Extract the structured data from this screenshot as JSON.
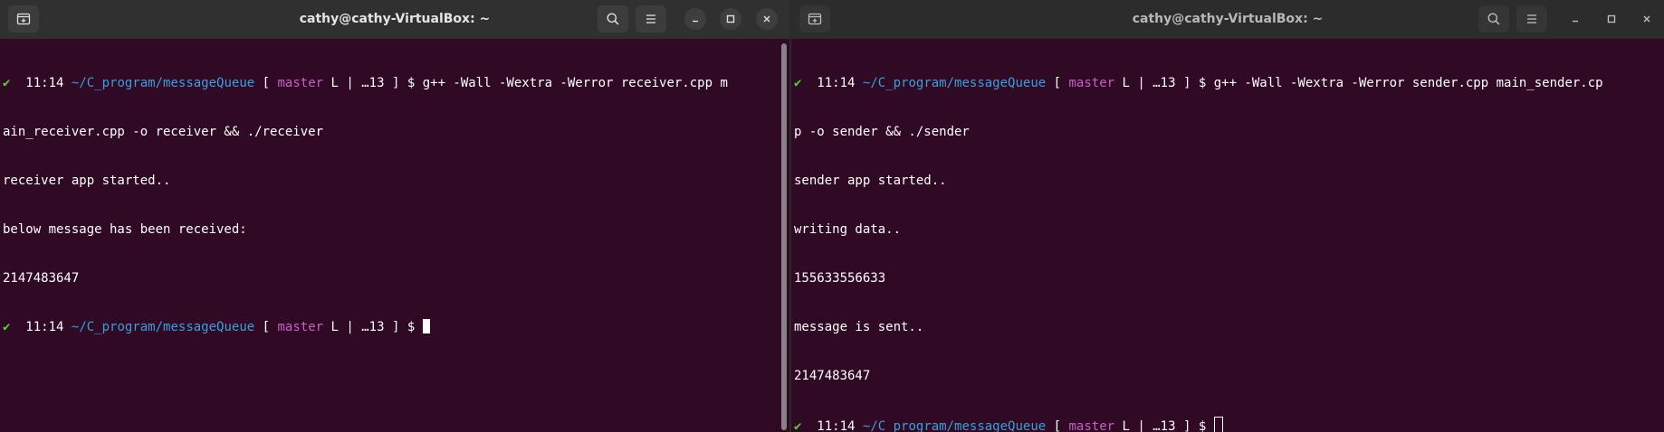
{
  "windows": [
    {
      "title": "cathy@cathy-VirtualBox: ~",
      "prompt": {
        "check": "✔",
        "time": "11:14",
        "path": "~/C_program/messageQueue",
        "open": "[",
        "branch": "master",
        "status": "L | …13",
        "close": "]",
        "dollar": "$"
      },
      "command_line1": "g++ -Wall -Wextra -Werror receiver.cpp m",
      "command_line2": "ain_receiver.cpp -o receiver && ./receiver",
      "output": [
        "receiver app started..",
        "below message has been received:",
        "2147483647"
      ]
    },
    {
      "title": "cathy@cathy-VirtualBox: ~",
      "prompt": {
        "check": "✔",
        "time": "11:14",
        "path": "~/C_program/messageQueue",
        "open": "[",
        "branch": "master",
        "status": "L | …13",
        "close": "]",
        "dollar": "$"
      },
      "command_line1": "g++ -Wall -Wextra -Werror sender.cpp main_sender.cp",
      "command_line2": "p -o sender && ./sender",
      "output": [
        "sender app started..",
        "writing data..",
        "155633556633",
        "message is sent..",
        "2147483647"
      ]
    }
  ],
  "icons": {
    "new_tab": "new-tab-icon",
    "search": "search-icon",
    "menu": "hamburger-menu-icon",
    "minimize": "minimize-icon",
    "maximize": "maximize-icon",
    "close": "close-icon"
  }
}
